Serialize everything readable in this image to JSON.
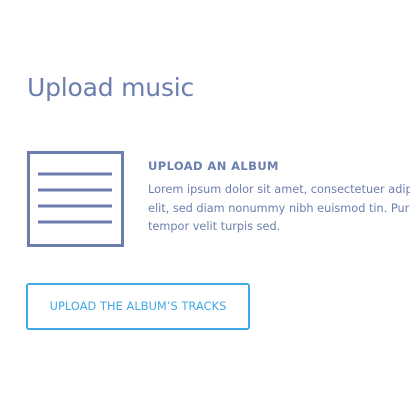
{
  "page": {
    "title": "Upload music"
  },
  "album_section": {
    "icon": "document-icon",
    "heading": "UPLOAD AN ALBUM",
    "description_lines": [
      "Lorem ipsum dolor sit amet, consectetuer adipis",
      "elit, sed diam nonummy nibh euismod tin. Purus",
      "tempor velit turpis sed."
    ]
  },
  "actions": {
    "upload_tracks_label": "UPLOAD THE ALBUM’S TRACKS"
  },
  "colors": {
    "text": "#6b7eae",
    "accent": "#3fa9e6",
    "background": "#ffffff"
  }
}
